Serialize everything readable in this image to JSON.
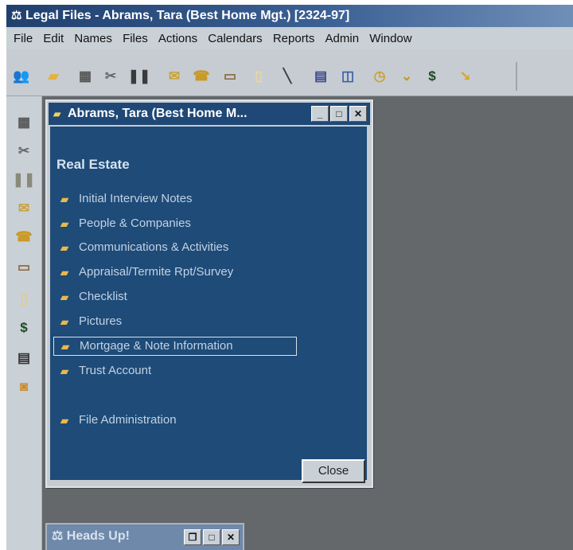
{
  "window": {
    "title": "Legal Files - Abrams, Tara  (Best Home Mgt.) [2324-97]"
  },
  "menu": [
    "File",
    "Edit",
    "Names",
    "Files",
    "Actions",
    "Calendars",
    "Reports",
    "Admin",
    "Window"
  ],
  "toolbar": {
    "icons": [
      "people-icon",
      "folder-icon",
      "calendar-grid-icon",
      "tools-icon",
      "footprints-icon",
      "envelope-icon",
      "phone-icon",
      "card-icon",
      "document-icon",
      "wand-icon",
      "report-icon",
      "preview-icon",
      "clock-icon",
      "dollar-icon",
      "key-icon"
    ]
  },
  "left_toolbar": {
    "icons": [
      "calendar-grid-icon",
      "tools-icon",
      "footprints-icon",
      "envelope-icon",
      "phone-icon",
      "card-icon",
      "document-icon",
      "dollar-icon",
      "notepad-icon",
      "folder-lock-icon"
    ]
  },
  "child_window": {
    "title": "Abrams, Tara  (Best Home M...",
    "section": "Real Estate",
    "items": [
      {
        "label": "Initial Interview Notes"
      },
      {
        "label": "People & Companies"
      },
      {
        "label": "Communications & Activities"
      },
      {
        "label": "Appraisal/Termite Rpt/Survey"
      },
      {
        "label": "Checklist"
      },
      {
        "label": "Pictures"
      },
      {
        "label": "Mortgage & Note Information",
        "selected": true
      },
      {
        "label": "Trust Account"
      },
      {
        "label": "File Administration"
      }
    ],
    "close_label": "Close"
  },
  "heads_up": {
    "title": "Heads Up!"
  },
  "colors": {
    "title_bar": "#20406e",
    "child_body": "#1e4b78",
    "workspace": "#64686a",
    "chrome": "#c9d0d6"
  }
}
